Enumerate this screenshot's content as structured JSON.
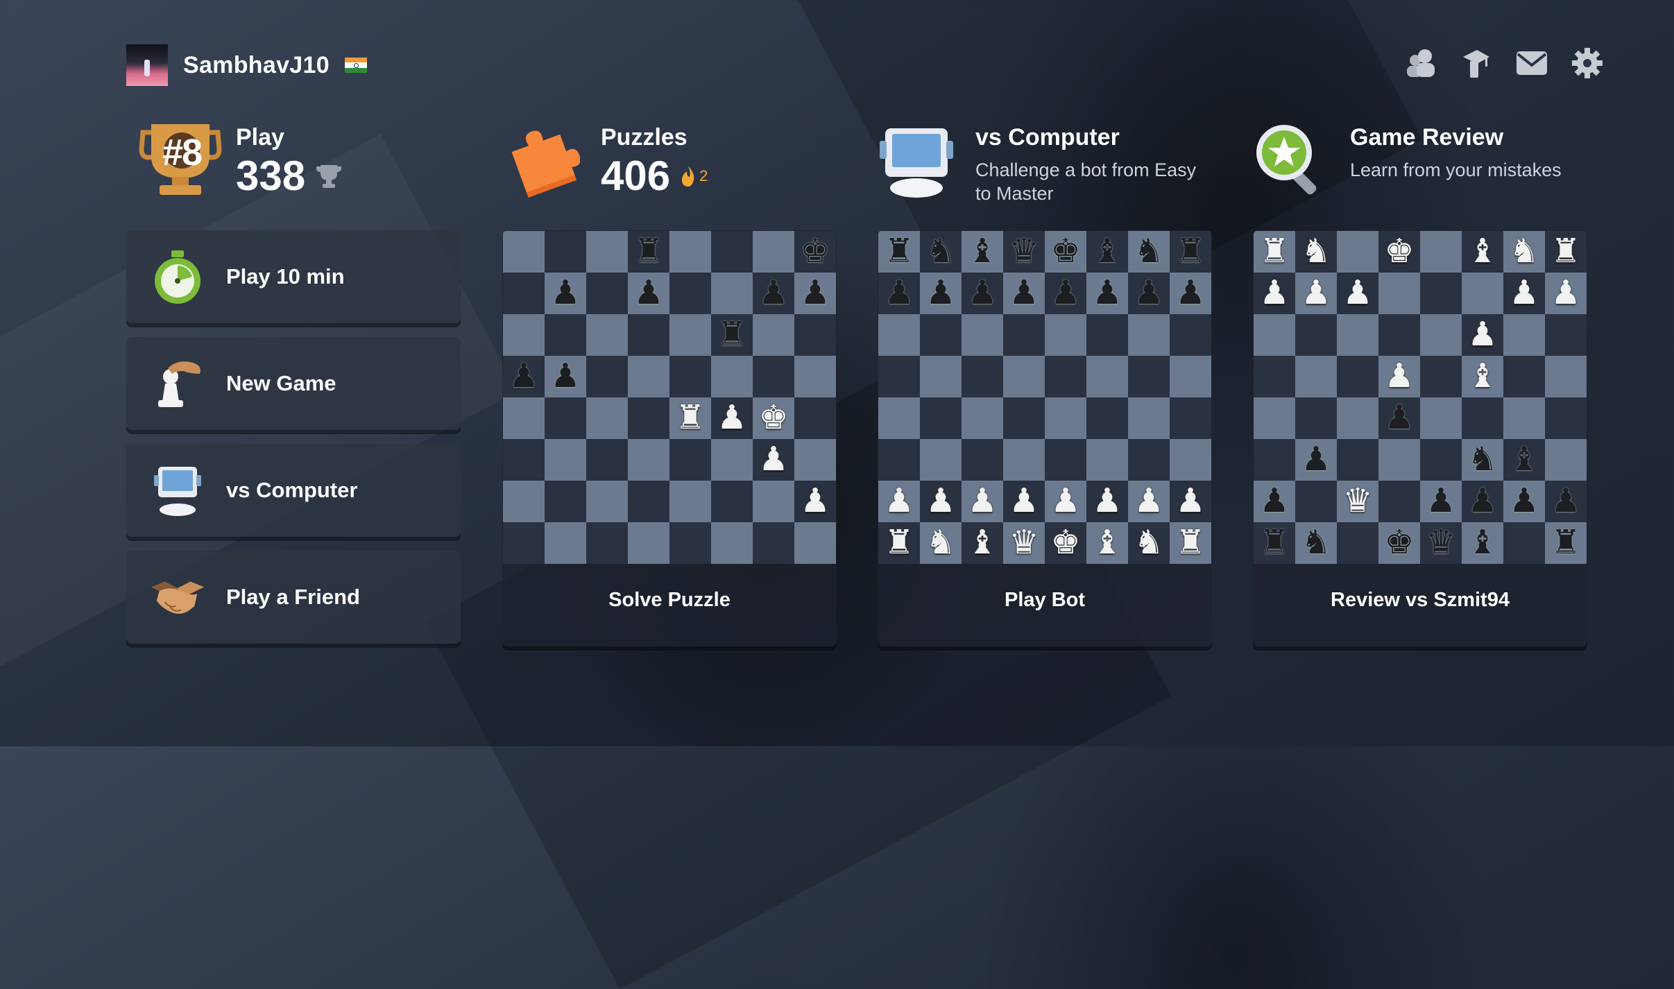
{
  "profile": {
    "username": "SambhavJ10",
    "flag": "India"
  },
  "top_icons": [
    "friends-icon",
    "learn-icon",
    "messages-icon",
    "settings-icon"
  ],
  "stats": {
    "play": {
      "title": "Play",
      "value": "338",
      "badge": "#8"
    },
    "puzzles": {
      "title": "Puzzles",
      "value": "406",
      "streak": "2"
    },
    "computer": {
      "title": "vs Computer",
      "desc": "Challenge a bot from Easy to Master"
    },
    "review": {
      "title": "Game Review",
      "desc": "Learn from your mistakes"
    }
  },
  "actions": [
    {
      "label": "Play 10 min",
      "icon": "stopwatch-icon"
    },
    {
      "label": "New Game",
      "icon": "hand-pawn-icon"
    },
    {
      "label": "vs Computer",
      "icon": "computer-icon"
    },
    {
      "label": "Play a Friend",
      "icon": "handshake-icon"
    }
  ],
  "cards": [
    {
      "label": "Solve Puzzle",
      "board": [
        [
          "",
          "",
          "",
          "br",
          "",
          "",
          "",
          "bk"
        ],
        [
          "",
          "bp",
          "",
          "bp",
          "",
          "",
          "bp",
          "bp"
        ],
        [
          "",
          "",
          "",
          "",
          "",
          "br",
          "",
          ""
        ],
        [
          "bp",
          "bp",
          "",
          "",
          "",
          "",
          "",
          ""
        ],
        [
          "",
          "",
          "",
          "",
          "wr",
          "wp",
          "wk",
          ""
        ],
        [
          "",
          "",
          "",
          "",
          "",
          "",
          "wp",
          ""
        ],
        [
          "",
          "",
          "",
          "",
          "",
          "",
          "",
          "wp"
        ],
        [
          "",
          "",
          "",
          "",
          "",
          "",
          "",
          ""
        ]
      ]
    },
    {
      "label": "Play Bot",
      "board": [
        [
          "br",
          "bn",
          "bb",
          "bq",
          "bk",
          "bb",
          "bn",
          "br"
        ],
        [
          "bp",
          "bp",
          "bp",
          "bp",
          "bp",
          "bp",
          "bp",
          "bp"
        ],
        [
          "",
          "",
          "",
          "",
          "",
          "",
          "",
          ""
        ],
        [
          "",
          "",
          "",
          "",
          "",
          "",
          "",
          ""
        ],
        [
          "",
          "",
          "",
          "",
          "",
          "",
          "",
          ""
        ],
        [
          "",
          "",
          "",
          "",
          "",
          "",
          "",
          ""
        ],
        [
          "wp",
          "wp",
          "wp",
          "wp",
          "wp",
          "wp",
          "wp",
          "wp"
        ],
        [
          "wr",
          "wn",
          "wb",
          "wq",
          "wk",
          "wb",
          "wn",
          "wr"
        ]
      ]
    },
    {
      "label": "Review vs Szmit94",
      "board": [
        [
          "wr",
          "wn",
          "",
          "wk",
          "",
          "wb",
          "wn",
          "wr"
        ],
        [
          "wp",
          "wp",
          "wp",
          "",
          "",
          "",
          "wp",
          "wp"
        ],
        [
          "",
          "",
          "",
          "",
          "",
          "wp",
          "",
          ""
        ],
        [
          "",
          "",
          "",
          "wp",
          "",
          "wb",
          "",
          ""
        ],
        [
          "",
          "",
          "",
          "bp",
          "",
          "",
          "",
          ""
        ],
        [
          "",
          "bp",
          "",
          "",
          "",
          "bn",
          "bb",
          ""
        ],
        [
          "bp",
          "",
          "wq",
          "",
          "bp",
          "bp",
          "bp",
          "bp"
        ],
        [
          "br",
          "bn",
          "",
          "bk",
          "bq",
          "bb",
          "",
          "br"
        ]
      ]
    }
  ]
}
